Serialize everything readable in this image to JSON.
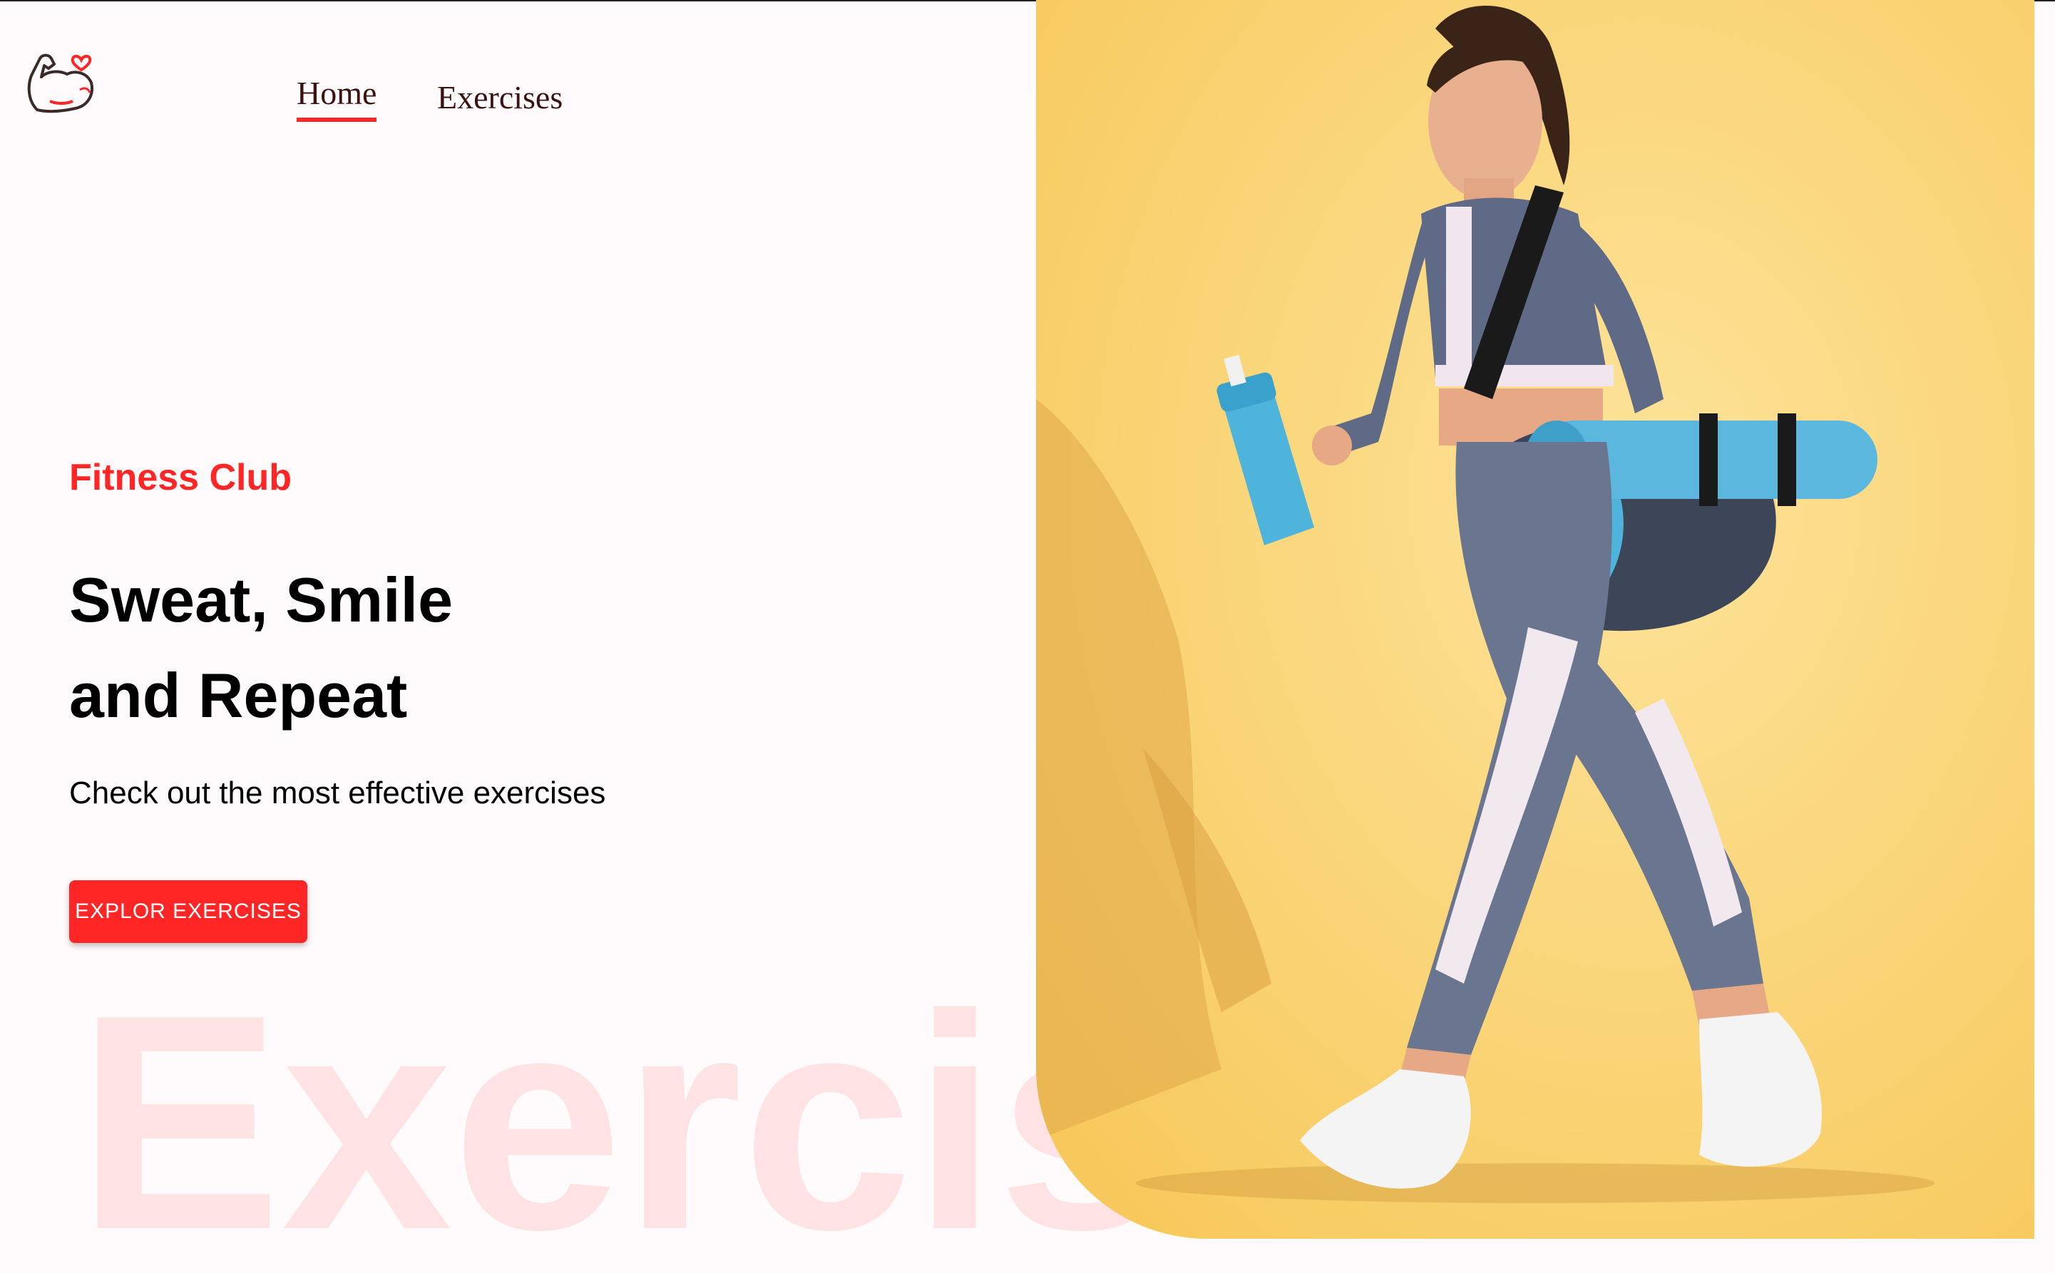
{
  "navbar": {
    "logo_icon": "flexed-arm-heart-icon",
    "links": [
      {
        "label": "Home",
        "active": true
      },
      {
        "label": "Exercises",
        "active": false
      }
    ],
    "accent_color": "#ff2625"
  },
  "hero": {
    "tag": "Fitness Club",
    "title_line1": "Sweat, Smile",
    "title_line2": "and Repeat",
    "subtitle": "Check out the most effective exercises",
    "button_label": "EXPLOR EXERCISES",
    "background_word": "Exercis"
  },
  "banner": {
    "image_subject": "woman-walking-with-gym-bag-and-water-bottle",
    "background_color": "#fbd777"
  }
}
